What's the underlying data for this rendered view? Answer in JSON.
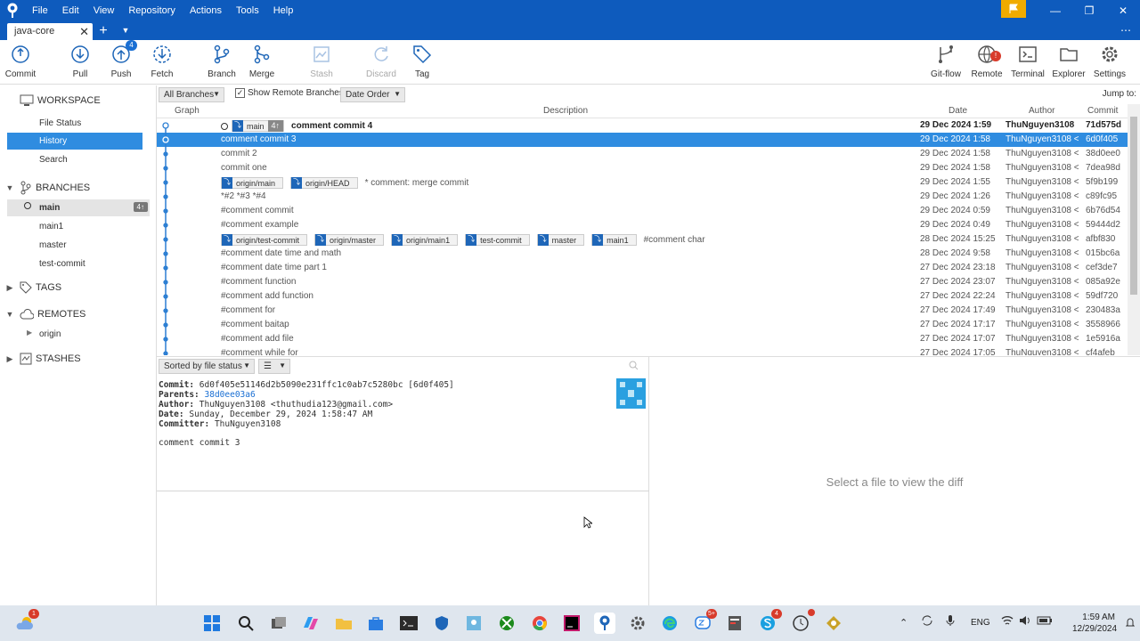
{
  "menu": [
    "File",
    "Edit",
    "View",
    "Repository",
    "Actions",
    "Tools",
    "Help"
  ],
  "tab": {
    "label": "java-core"
  },
  "toolbar": [
    {
      "label": "Commit",
      "icon": "commit-icon",
      "enabled": true
    },
    {
      "label": "Pull",
      "icon": "pull-icon",
      "enabled": true
    },
    {
      "label": "Push",
      "icon": "push-icon",
      "enabled": true,
      "badge": "4"
    },
    {
      "label": "Fetch",
      "icon": "fetch-icon",
      "enabled": true
    },
    {
      "label": "Branch",
      "icon": "branch-icon",
      "enabled": true
    },
    {
      "label": "Merge",
      "icon": "merge-icon",
      "enabled": true
    },
    {
      "label": "Stash",
      "icon": "stash-icon",
      "enabled": false
    },
    {
      "label": "Discard",
      "icon": "discard-icon",
      "enabled": false
    },
    {
      "label": "Tag",
      "icon": "tag-icon",
      "enabled": true
    },
    {
      "label": "Git-flow",
      "icon": "git-flow-icon",
      "enabled": true
    },
    {
      "label": "Remote",
      "icon": "remote-icon",
      "enabled": true,
      "badge": "!"
    },
    {
      "label": "Terminal",
      "icon": "terminal-icon",
      "enabled": true
    },
    {
      "label": "Explorer",
      "icon": "explorer-icon",
      "enabled": true
    },
    {
      "label": "Settings",
      "icon": "settings-icon",
      "enabled": true
    }
  ],
  "sidebar": {
    "workspace": "WORKSPACE",
    "workspace_items": [
      "File Status",
      "History",
      "Search"
    ],
    "branches": "BRANCHES",
    "branch_items": [
      "main",
      "main1",
      "master",
      "test-commit"
    ],
    "current_branch_count": "4↑",
    "tags": "TAGS",
    "remotes": "REMOTES",
    "remote_items": [
      "origin"
    ],
    "stashes": "STASHES"
  },
  "filter": {
    "branches": "All Branches",
    "show_remote": "Show Remote Branches",
    "order": "Date Order",
    "jump": "Jump to:"
  },
  "columns": {
    "graph": "Graph",
    "description": "Description",
    "date": "Date",
    "author": "Author",
    "commit": "Commit"
  },
  "commits": [
    {
      "tags": [
        {
          "name": "main",
          "count": "4↑"
        }
      ],
      "message": "comment commit 4",
      "date": "29 Dec 2024 1:59",
      "author": "ThuNguyen3108",
      "hash": "71d575d",
      "bold": true
    },
    {
      "tags": [],
      "message": "comment commit 3",
      "date": "29 Dec 2024 1:58",
      "author": "ThuNguyen3108 <",
      "hash": "6d0f405",
      "selected": true
    },
    {
      "tags": [],
      "message": "commit 2",
      "date": "29 Dec 2024 1:58",
      "author": "ThuNguyen3108 <",
      "hash": "38d0ee0"
    },
    {
      "tags": [],
      "message": "commit one",
      "date": "29 Dec 2024 1:58",
      "author": "ThuNguyen3108 <",
      "hash": "7dea98d"
    },
    {
      "tags": [
        {
          "name": "origin/main"
        },
        {
          "name": "origin/HEAD"
        }
      ],
      "message": "* comment: merge commit",
      "date": "29 Dec 2024 1:55",
      "author": "ThuNguyen3108 <",
      "hash": "5f9b199"
    },
    {
      "tags": [],
      "message": "*#2 *#3 *#4",
      "date": "29 Dec 2024 1:26",
      "author": "ThuNguyen3108 <",
      "hash": "c89fc95"
    },
    {
      "tags": [],
      "message": "#comment commit",
      "date": "29 Dec 2024 0:59",
      "author": "ThuNguyen3108 <",
      "hash": "6b76d54"
    },
    {
      "tags": [],
      "message": "#comment example",
      "date": "29 Dec 2024 0:49",
      "author": "ThuNguyen3108 <",
      "hash": "59444d2"
    },
    {
      "tags": [
        {
          "name": "origin/test-commit"
        },
        {
          "name": "origin/master"
        },
        {
          "name": "origin/main1"
        },
        {
          "name": "test-commit"
        },
        {
          "name": "master"
        },
        {
          "name": "main1"
        }
      ],
      "message": "#comment char",
      "date": "28 Dec 2024 15:25",
      "author": "ThuNguyen3108 <",
      "hash": "afbf830"
    },
    {
      "tags": [],
      "message": "#comment date time and math",
      "date": "28 Dec 2024 9:58",
      "author": "ThuNguyen3108 <",
      "hash": "015bc6a"
    },
    {
      "tags": [],
      "message": "#comment date time part 1",
      "date": "27 Dec 2024 23:18",
      "author": "ThuNguyen3108 <",
      "hash": "cef3de7"
    },
    {
      "tags": [],
      "message": "#comment function",
      "date": "27 Dec 2024 23:07",
      "author": "ThuNguyen3108 <",
      "hash": "085a92e"
    },
    {
      "tags": [],
      "message": "#comment add function",
      "date": "27 Dec 2024 22:24",
      "author": "ThuNguyen3108 <",
      "hash": "59df720"
    },
    {
      "tags": [],
      "message": "#comment for",
      "date": "27 Dec 2024 17:49",
      "author": "ThuNguyen3108 <",
      "hash": "230483a"
    },
    {
      "tags": [],
      "message": "#comment baitap",
      "date": "27 Dec 2024 17:17",
      "author": "ThuNguyen3108 <",
      "hash": "3558966"
    },
    {
      "tags": [],
      "message": "#comment add file",
      "date": "27 Dec 2024 17:07",
      "author": "ThuNguyen3108 <",
      "hash": "1e5916a"
    },
    {
      "tags": [],
      "message": "#comment while for",
      "date": "27 Dec 2024 17:05",
      "author": "ThuNguyen3108 <",
      "hash": "cf4afeb"
    }
  ],
  "details": {
    "sort_label": "Sorted by file status",
    "commit_label": "Commit:",
    "commit_value": "6d0f405e51146d2b5090e231ffc1c0ab7c5280bc [6d0f405]",
    "parents_label": "Parents:",
    "parents_value": "38d0ee03a6",
    "author_label": "Author:",
    "author_value": "ThuNguyen3108 <thuthudia123@gmail.com>",
    "date_label": "Date:",
    "date_value": "Sunday, December 29, 2024 1:58:47 AM",
    "committer_label": "Committer:",
    "committer_value": "ThuNguyen3108",
    "message": "comment commit 3"
  },
  "diff": {
    "empty": "Select a file to view the diff"
  },
  "taskbar": {
    "tray_lang": "ENG",
    "time": "1:59 AM",
    "date": "12/29/2024"
  },
  "colors": {
    "accent": "#0e5bbd",
    "selection": "#2f8ce0",
    "graph": "#2d7fd3"
  }
}
